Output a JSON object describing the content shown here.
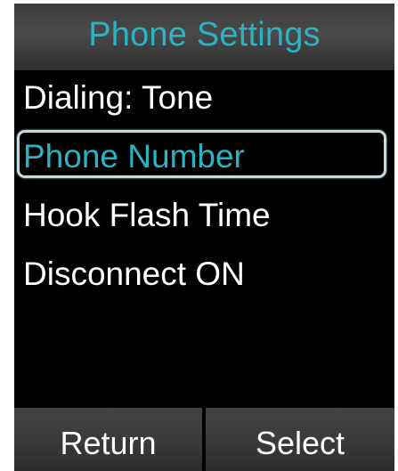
{
  "title_bar": {
    "title": "Phone Settings"
  },
  "menu": {
    "items": [
      {
        "label": "Dialing: Tone"
      },
      {
        "label": "Phone Number"
      },
      {
        "label": "Hook Flash Time"
      },
      {
        "label": "Disconnect ON"
      }
    ],
    "selected_index": 1
  },
  "softkeys": {
    "left_label": "Return",
    "right_label": "Select"
  },
  "colors": {
    "accent": "#2bb3c4",
    "background": "#000000",
    "text": "#ffffff"
  }
}
